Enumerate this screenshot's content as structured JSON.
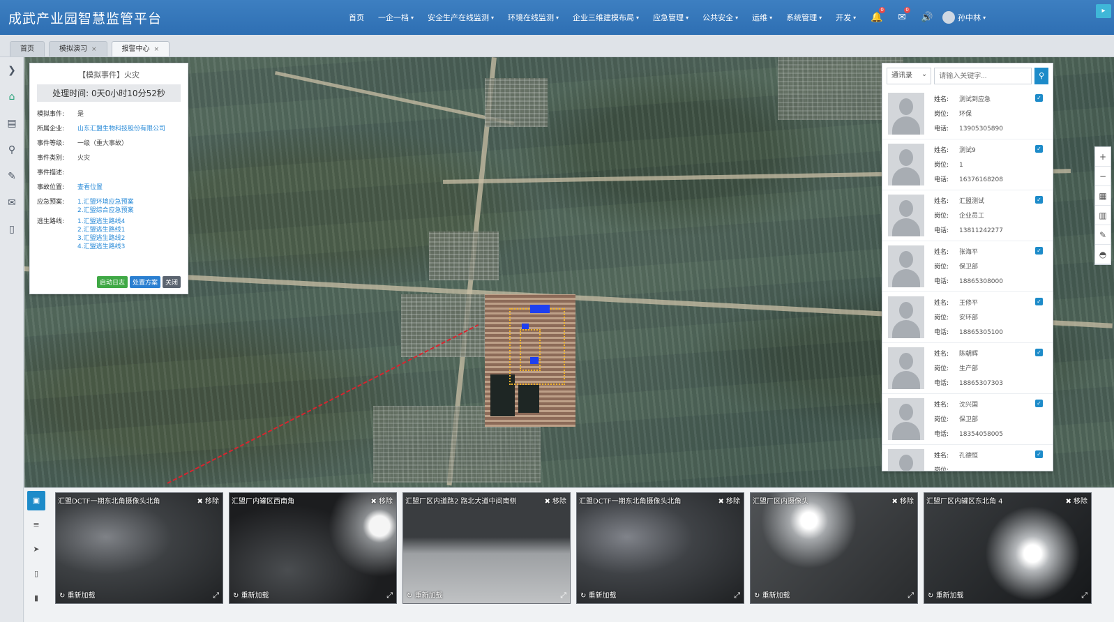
{
  "header": {
    "title": "成武产业园智慧监管平台",
    "nav": [
      {
        "label": "首页",
        "has_menu": false
      },
      {
        "label": "一企一档",
        "has_menu": true
      },
      {
        "label": "安全生产在线监测",
        "has_menu": true
      },
      {
        "label": "环境在线监测",
        "has_menu": true
      },
      {
        "label": "企业三维建模布局",
        "has_menu": true
      },
      {
        "label": "应急管理",
        "has_menu": true
      },
      {
        "label": "公共安全",
        "has_menu": true
      },
      {
        "label": "运维",
        "has_menu": true
      },
      {
        "label": "系统管理",
        "has_menu": true
      },
      {
        "label": "开发",
        "has_menu": true
      }
    ],
    "notifications": {
      "alerts": "0",
      "messages": "0"
    },
    "user_name": "孙中林"
  },
  "tabs": [
    {
      "label": "首页",
      "active": false,
      "closable": false
    },
    {
      "label": "模拟演习",
      "active": false,
      "closable": true
    },
    {
      "label": "报警中心",
      "active": true,
      "closable": true
    }
  ],
  "event": {
    "title": "【模拟事件】火灾",
    "handle_time_label": "处理时间:",
    "handle_time": "0天0小时10分52秒",
    "rows": [
      {
        "key": "模拟事件:",
        "value": "是",
        "link": false
      },
      {
        "key": "所属企业:",
        "value": "山东汇盟生物科技股份有限公司",
        "link": true
      },
      {
        "key": "事件等级:",
        "value": "一级（重大事故）",
        "link": false
      },
      {
        "key": "事件类别:",
        "value": "火灾",
        "link": false
      },
      {
        "key": "事件描述:",
        "value": "",
        "link": false
      },
      {
        "key": "事故位置:",
        "value": "查看位置",
        "link": true
      }
    ],
    "plans_label": "应急预案:",
    "plans": [
      "1.汇盟环境应急预案",
      "2.汇盟综合应急预案"
    ],
    "routes_label": "逃生路线:",
    "routes": [
      "1.汇盟逃生路线4",
      "2.汇盟逃生路线1",
      "3.汇盟逃生路线2",
      "4.汇盟逃生路线3"
    ],
    "buttons": {
      "log": "启动日志",
      "plan": "处置方案",
      "close": "关闭"
    }
  },
  "people": {
    "select_value": "通讯录",
    "search_placeholder": "请输入关键字...",
    "labels": {
      "name": "姓名:",
      "post": "岗位:",
      "phone": "电话:"
    },
    "list": [
      {
        "name": "测试到应急",
        "post": "环保",
        "phone": "13905305890"
      },
      {
        "name": "测试9",
        "post": "1",
        "phone": "16376168208"
      },
      {
        "name": "汇盟测试",
        "post": "企业员工",
        "phone": "13811242277"
      },
      {
        "name": "张海平",
        "post": "保卫部",
        "phone": "18865308000"
      },
      {
        "name": "王修平",
        "post": "安环部",
        "phone": "18865305100"
      },
      {
        "name": "陈朝辉",
        "post": "生产部",
        "phone": "18865307303"
      },
      {
        "name": "沈兴国",
        "post": "保卫部",
        "phone": "18354058005"
      },
      {
        "name": "孔德恒",
        "post": "",
        "phone": ""
      }
    ]
  },
  "videos": [
    {
      "caption": "汇盟DCTF一期东北角摄像头北角",
      "remove": "移除",
      "reload": "重新加载"
    },
    {
      "caption": "汇盟厂内罐区西南角",
      "remove": "移除",
      "reload": "重新加载"
    },
    {
      "caption": "汇盟厂区内道路2 路北大道中间南侧",
      "remove": "移除",
      "reload": "重新加载"
    },
    {
      "caption": "汇盟DCTF一期东北角摄像头北角",
      "remove": "移除",
      "reload": "重新加载"
    },
    {
      "caption": "汇盟厂区内摄像头",
      "remove": "移除",
      "reload": "重新加载"
    },
    {
      "caption": "汇盟厂区内罐区东北角 4",
      "remove": "移除",
      "reload": "重新加载"
    }
  ]
}
